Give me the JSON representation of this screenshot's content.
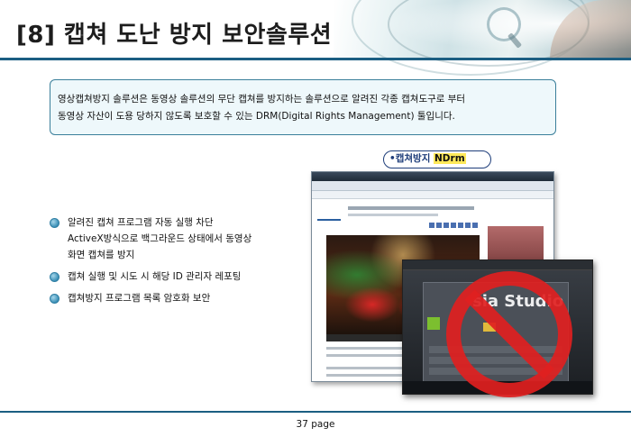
{
  "header": {
    "title": "[8] 캡쳐 도난 방지 보안솔루션"
  },
  "description": {
    "line1": "영상캡쳐방지 솔루션은 동영상 솔루션의 무단 캡쳐를 방지하는 솔루션으로 알려진 각종 캡쳐도구로 부터",
    "line2": "동영상 자산이 도용 당하지 않도록 보호할 수 있는 DRM(Digital Rights Management) 툴입니다."
  },
  "badge": {
    "prefix": "•캡쳐방지 ",
    "highlight": "NDrm"
  },
  "bullets": {
    "item1_line1": "알려진 캡쳐 프로그램 자동 실행 차단",
    "item1_line2": "ActiveX방식으로 백그라운드 상태에서 동영상",
    "item1_line3": "화면 캡쳐를 방지",
    "item2": "캡쳐 실행 및 시도 시 해당 ID 관리자  레포팅",
    "item3": "캡쳐방지 프로그램 목록 암호화 보안"
  },
  "screenshot": {
    "studio_title": "sia Studio"
  },
  "footer": {
    "page": "37 page"
  },
  "colors": {
    "rule": "#1b5e82",
    "box_border": "#3a7f9a",
    "box_fill": "#eef8fb",
    "no_sign": "#e02020"
  }
}
